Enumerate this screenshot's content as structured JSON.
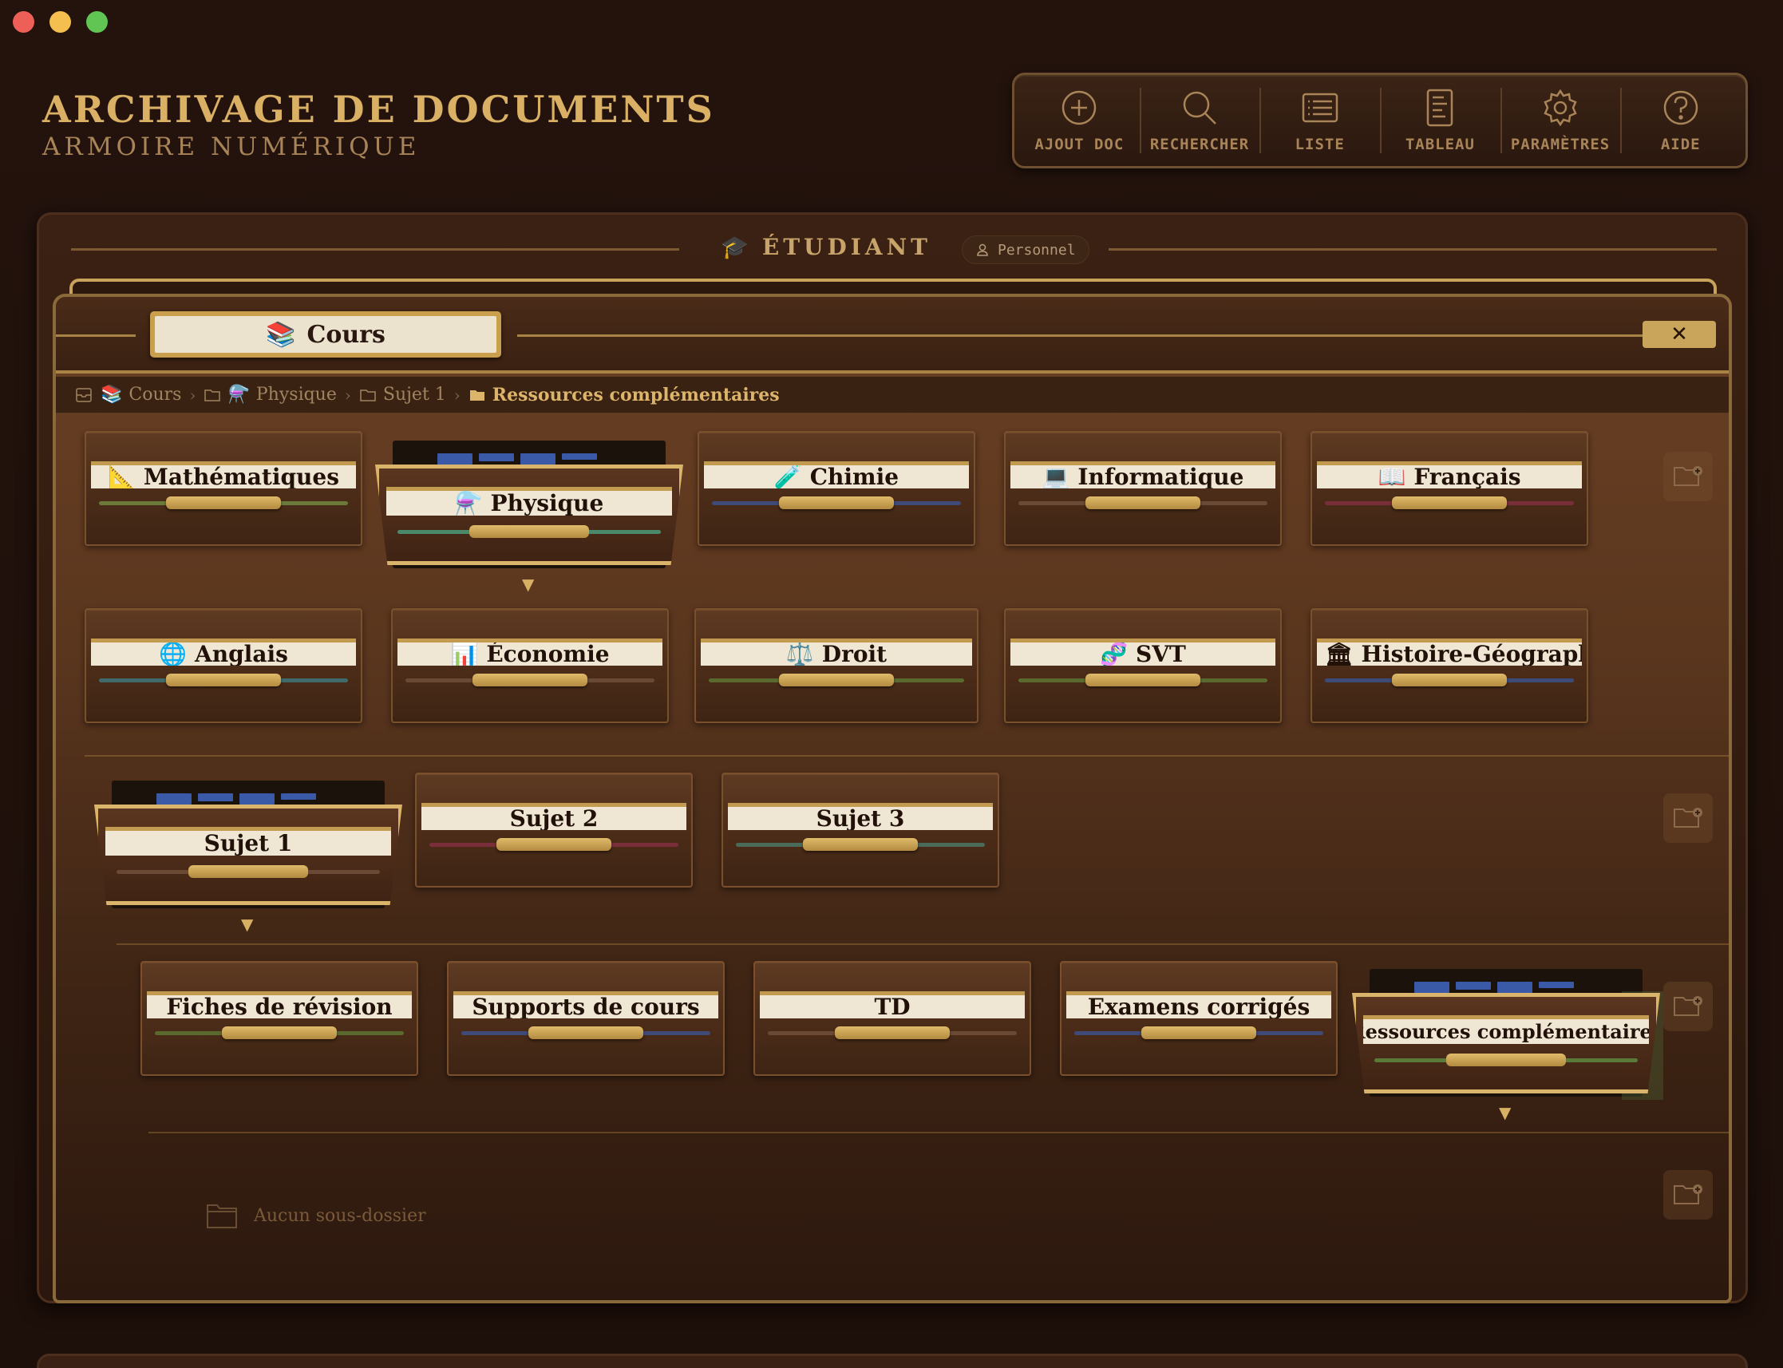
{
  "app": {
    "title": "ARCHIVAGE DE DOCUMENTS",
    "subtitle": "ARMOIRE NUMÉRIQUE"
  },
  "toolbar": {
    "items": [
      {
        "label": "AJOUT DOC",
        "icon": "plus-circle-icon"
      },
      {
        "label": "RECHERCHER",
        "icon": "search-icon"
      },
      {
        "label": "LISTE",
        "icon": "list-icon"
      },
      {
        "label": "TABLEAU",
        "icon": "table-icon"
      },
      {
        "label": "PARAMÈTRES",
        "icon": "gear-icon"
      },
      {
        "label": "AIDE",
        "icon": "help-icon"
      }
    ]
  },
  "cabinet": {
    "emoji": "🎓",
    "label": "ÉTUDIANT",
    "badge": "Personnel"
  },
  "drawer": {
    "emoji": "📚",
    "label": "Cours",
    "close_symbol": "✕"
  },
  "breadcrumb": [
    {
      "emoji": "📚",
      "label": "Cours"
    },
    {
      "emoji": "⚗️",
      "label": "Physique"
    },
    {
      "emoji": "",
      "label": "Sujet 1"
    },
    {
      "emoji": "",
      "label": "Ressources complémentaires"
    }
  ],
  "subjects": [
    {
      "emoji": "📐",
      "label": "Mathématiques",
      "color": "#6b7a3a"
    },
    {
      "emoji": "⚗️",
      "label": "Physique",
      "color": "#4a8a6a",
      "open": true
    },
    {
      "emoji": "🧪",
      "label": "Chimie",
      "color": "#3e4a78"
    },
    {
      "emoji": "💻",
      "label": "Informatique",
      "color": "#6a4a34"
    },
    {
      "emoji": "📖",
      "label": "Français",
      "color": "#7a2e3a"
    },
    {
      "emoji": "🌐",
      "label": "Anglais",
      "color": "#3e6a6a"
    },
    {
      "emoji": "📊",
      "label": "Économie",
      "color": "#6a4a34"
    },
    {
      "emoji": "⚖️",
      "label": "Droit",
      "color": "#5a6a2e"
    },
    {
      "emoji": "🧬",
      "label": "SVT",
      "color": "#5a6a2e"
    },
    {
      "emoji": "🏛",
      "label": "Histoire-Géographie",
      "color": "#3e4a78"
    }
  ],
  "topics": [
    {
      "label": "Sujet 1",
      "color": "#6a4a34",
      "open": true
    },
    {
      "label": "Sujet 2",
      "color": "#7a2e3a"
    },
    {
      "label": "Sujet 3",
      "color": "#4a6a5a"
    }
  ],
  "resources": [
    {
      "label": "Fiches de révision",
      "color": "#5a6a2e"
    },
    {
      "label": "Supports de cours",
      "color": "#3e4a78"
    },
    {
      "label": "TD",
      "color": "#6a4a34"
    },
    {
      "label": "Examens corrigés",
      "color": "#3e4a78"
    },
    {
      "label": "Ressources complémentaires",
      "color": "#5a7a3a",
      "open": true
    }
  ],
  "empty_text": "Aucun sous-dossier"
}
